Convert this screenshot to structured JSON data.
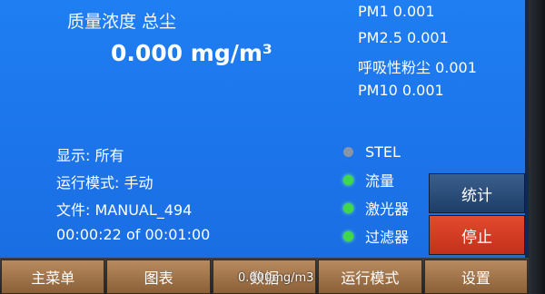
{
  "header": {
    "title": "质量浓度 总尘",
    "main_value": "0.000 mg/m³"
  },
  "pm_readings": [
    "PM1 0.001",
    "PM2.5 0.001",
    "呼吸性粉尘 0.001",
    "PM10 0.001"
  ],
  "info": {
    "display": "显示: 所有",
    "mode": "运行模式: 手动",
    "file": "文件: MANUAL_494",
    "elapsed": "00:00:22 of 00:01:00"
  },
  "indicators": [
    {
      "label": "STEL",
      "status": "gray"
    },
    {
      "label": "流量",
      "status": "green"
    },
    {
      "label": "激光器",
      "status": "green"
    },
    {
      "label": "过滤器",
      "status": "green"
    }
  ],
  "side_buttons": {
    "stats": "统计",
    "stop": "停止"
  },
  "bottom_menu": [
    "主菜单",
    "图表",
    "数据",
    "运行模式",
    "设置"
  ],
  "overlay_caption": "0.000mg/m3",
  "colors": {
    "screen_blue": "#1c74ea",
    "stop_red": "#d33a22",
    "stats_blue": "#2a4f7c",
    "indicator_green": "#3fd84a",
    "indicator_gray": "#8a94a6",
    "menu_tan": "#a87a4e"
  }
}
